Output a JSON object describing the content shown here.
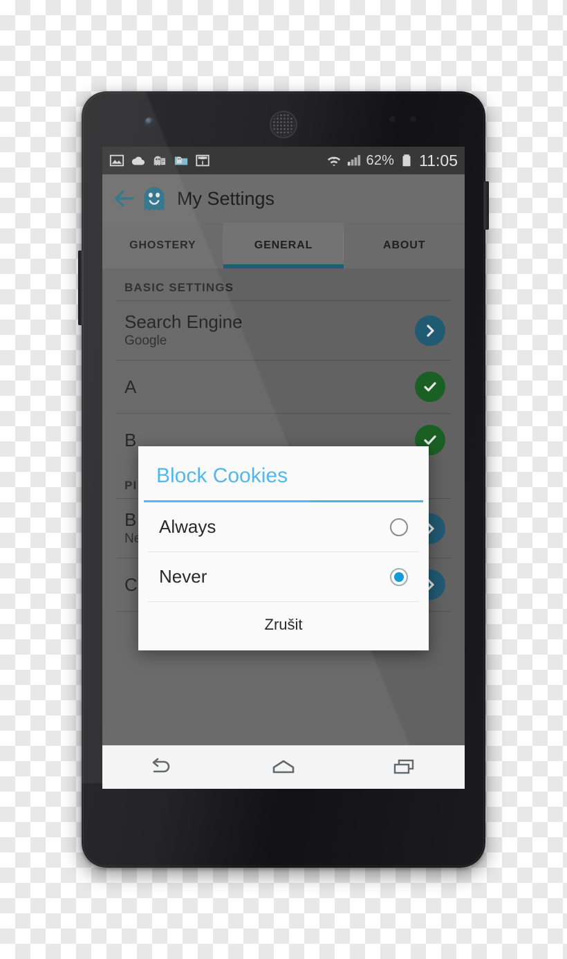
{
  "status_bar": {
    "left_icons": [
      "image-icon",
      "cloud-icon",
      "ghostery-notification-icon",
      "folder-icon",
      "usb-storage-icon"
    ],
    "battery_percent": "62%",
    "clock": "11:05",
    "wifi_icon": "wifi-icon",
    "signal_icon": "cellular-signal-icon",
    "battery_icon": "battery-icon"
  },
  "app_bar": {
    "back_icon": "back-arrow-icon",
    "logo_icon": "ghostery-ghost-icon",
    "title": "My Settings"
  },
  "tabs": [
    {
      "label": "GHOSTERY",
      "active": false
    },
    {
      "label": "GENERAL",
      "active": true
    },
    {
      "label": "ABOUT",
      "active": false
    }
  ],
  "sections": [
    {
      "header": "BASIC SETTINGS",
      "rows": [
        {
          "title": "Search Engine",
          "subtitle": "Google",
          "control": "chevron"
        },
        {
          "title": "A",
          "subtitle": "",
          "control": "check"
        },
        {
          "title": "B",
          "subtitle": "",
          "control": "check"
        }
      ]
    },
    {
      "header": "PI",
      "rows": [
        {
          "title": "B",
          "subtitle": "Never",
          "control": "chevron"
        },
        {
          "title": "Clear history",
          "subtitle": "",
          "control": "chevron"
        }
      ]
    }
  ],
  "dialog": {
    "title": "Block Cookies",
    "options": [
      {
        "label": "Always",
        "selected": false
      },
      {
        "label": "Never",
        "selected": true
      }
    ],
    "cancel_label": "Zrušit"
  },
  "nav_bar": {
    "back": "nav-back-icon",
    "home": "nav-home-icon",
    "recents": "nav-recents-icon"
  },
  "colors": {
    "accent_teal": "#256580",
    "tab_indicator": "#1f6a82",
    "dialog_blue": "#4ab3e8",
    "radio_selected": "#149bd7",
    "check_green": "#1d6b2a"
  }
}
